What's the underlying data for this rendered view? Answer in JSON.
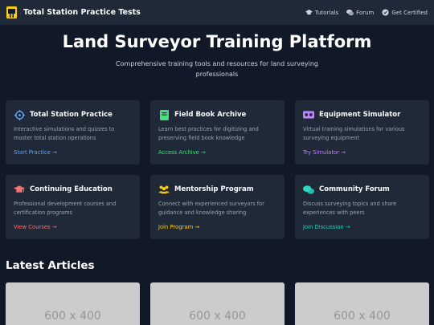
{
  "header": {
    "brand": "Total Station Practice Tests",
    "nav": [
      {
        "label": "Tutorials",
        "icon": "graduation-icon"
      },
      {
        "label": "Forum",
        "icon": "chat-icon"
      },
      {
        "label": "Get Certified",
        "icon": "badge-icon"
      }
    ]
  },
  "hero": {
    "title": "Land Surveyor Training Platform",
    "subtitle": "Comprehensive training tools and resources for land surveying professionals"
  },
  "cards": [
    {
      "title": "Total Station Practice",
      "description": "Interactive simulations and quizzes to master total station operations",
      "link": "Start Practice →",
      "icon": "crosshair-icon",
      "color": "#60a5fa"
    },
    {
      "title": "Field Book Archive",
      "description": "Learn best practices for digitizing and preserving field book knowledge",
      "link": "Access Archive →",
      "icon": "book-icon",
      "color": "#4ade80"
    },
    {
      "title": "Equipment Simulator",
      "description": "Virtual training simulations for various surveying equipment",
      "link": "Try Simulator →",
      "icon": "vr-headset-icon",
      "color": "#c084fc"
    },
    {
      "title": "Continuing Education",
      "description": "Professional development courses and certification programs",
      "link": "View Courses →",
      "icon": "graduation-cap-icon",
      "color": "#f87171"
    },
    {
      "title": "Mentorship Program",
      "description": "Connect with experienced surveyors for guidance and knowledge sharing",
      "link": "Join Program →",
      "icon": "users-icon",
      "color": "#facc15"
    },
    {
      "title": "Community Forum",
      "description": "Discuss surveying topics and share experiences with peers",
      "link": "Join Discussion →",
      "icon": "comments-icon",
      "color": "#2dd4bf"
    }
  ],
  "articles": {
    "heading": "Latest Articles",
    "items": [
      {
        "placeholder": "600 x 400"
      },
      {
        "placeholder": "600 x 400"
      },
      {
        "placeholder": "600 x 400"
      }
    ]
  }
}
